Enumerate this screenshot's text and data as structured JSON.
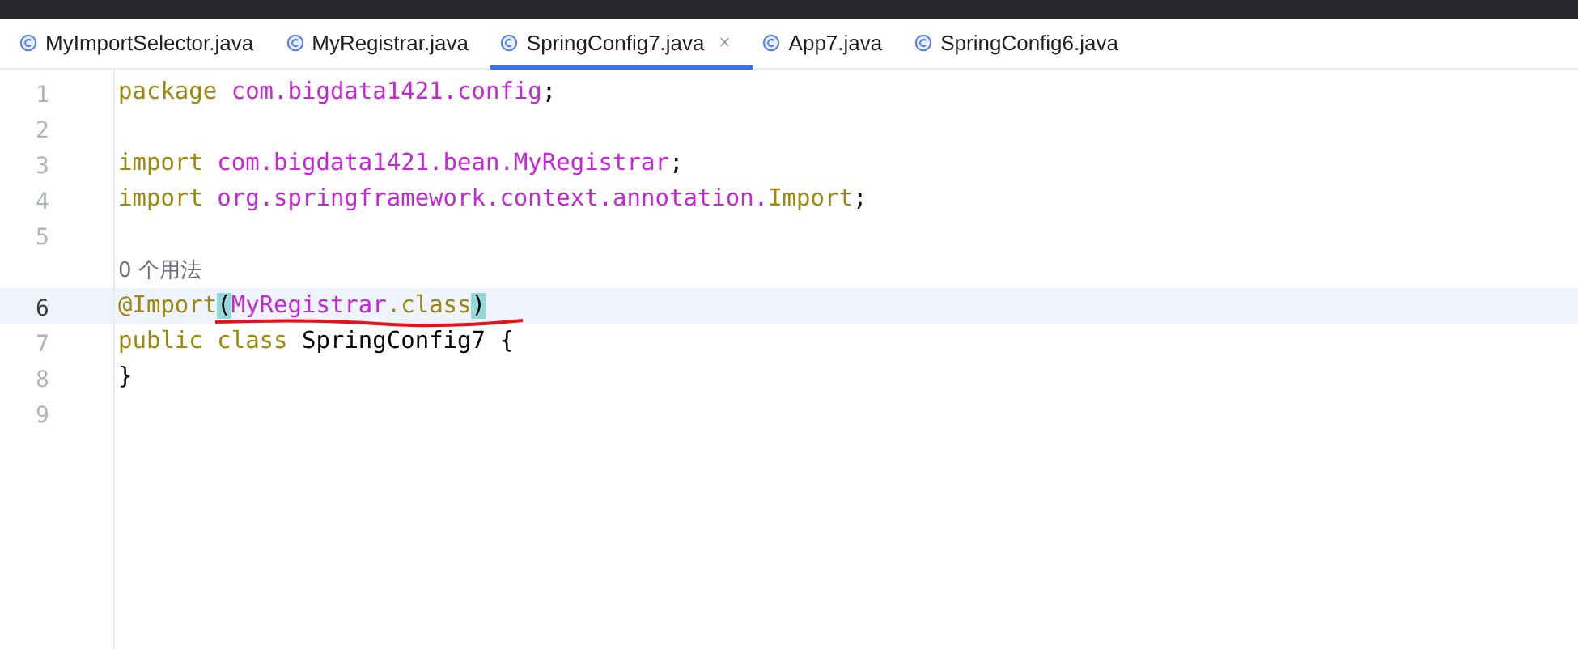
{
  "tabs": [
    {
      "label": "MyImportSelector.java",
      "selected": false
    },
    {
      "label": "MyRegistrar.java",
      "selected": false
    },
    {
      "label": "SpringConfig7.java",
      "selected": true,
      "close": "×"
    },
    {
      "label": "App7.java",
      "selected": false
    },
    {
      "label": "SpringConfig6.java",
      "selected": false
    }
  ],
  "editor": {
    "lines": [
      {
        "number": "1",
        "current": false,
        "tokens": [
          {
            "kind": "keyword",
            "text": "package "
          },
          {
            "kind": "ident",
            "text": "com.bigdata1421.config"
          },
          {
            "kind": "plain",
            "text": ";"
          }
        ]
      },
      {
        "number": "2",
        "current": false
      },
      {
        "number": "3",
        "current": false,
        "tokens": [
          {
            "kind": "keyword",
            "text": "import "
          },
          {
            "kind": "ident",
            "text": "com.bigdata1421.bean.MyRegistrar"
          },
          {
            "kind": "plain",
            "text": ";"
          }
        ]
      },
      {
        "number": "4",
        "current": false,
        "tokens": [
          {
            "kind": "keyword",
            "text": "import "
          },
          {
            "kind": "ident",
            "text": "org.springframework.context.annotation."
          },
          {
            "kind": "keyword",
            "text": "Import"
          },
          {
            "kind": "plain",
            "text": ";"
          }
        ]
      },
      {
        "number": "5",
        "current": false
      },
      {
        "number": "6",
        "current": true,
        "hint": "0 个用法",
        "underlined": true,
        "tokens": [
          {
            "kind": "keyword",
            "text": "@Import"
          },
          {
            "kind": "match",
            "text": "("
          },
          {
            "kind": "ident",
            "text": "MyRegistrar"
          },
          {
            "kind": "keyword",
            "text": ".class"
          },
          {
            "kind": "match",
            "text": ")"
          }
        ]
      },
      {
        "number": "7",
        "current": false,
        "tokens": [
          {
            "kind": "keyword",
            "text": "public class "
          },
          {
            "kind": "plain",
            "text": "SpringConfig7 {"
          }
        ]
      },
      {
        "number": "8",
        "current": false,
        "tokens": [
          {
            "kind": "plain",
            "text": "}"
          }
        ]
      },
      {
        "number": "9",
        "current": false
      }
    ]
  }
}
